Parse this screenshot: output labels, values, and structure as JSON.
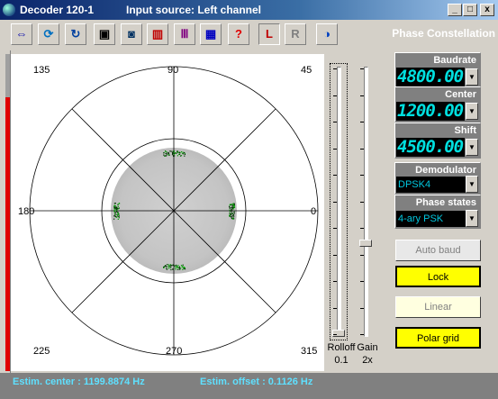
{
  "window": {
    "title": "Decoder 120-1",
    "input_source": "Input source: Left channel",
    "controls": [
      "_",
      "□",
      "x"
    ]
  },
  "panel_title": "Phase Constellation",
  "plot": {
    "angles": {
      "a0": "0",
      "a45": "45",
      "a90": "90",
      "a135": "135",
      "a180": "180",
      "a225": "225",
      "a270": "270",
      "a315": "315"
    }
  },
  "sliders": {
    "rolloff_label": "Rolloff",
    "rolloff_value": "0.1",
    "gain_label": "Gain",
    "gain_value": "2x"
  },
  "params": {
    "baudrate_label": "Baudrate",
    "baudrate_value": "4800.00",
    "center_label": "Center",
    "center_value": "1200.00",
    "shift_label": "Shift",
    "shift_value": "4500.00",
    "demodulator_label": "Demodulator",
    "demodulator_value": "DPSK4",
    "phase_states_label": "Phase states",
    "phase_states_value": "4-ary PSK"
  },
  "buttons": {
    "auto_baud": "Auto baud",
    "lock": "Lock",
    "linear": "Linear",
    "polar_grid": "Polar grid"
  },
  "status": {
    "center": "Estim. center :  1199.8874 Hz",
    "offset": "Estim. offset : 0.1126 Hz"
  },
  "colors": {
    "lcd_text": "#00e0e0",
    "active_button": "#ffff00",
    "status_text": "#5fe0ff",
    "signal_level": "#e00000"
  }
}
